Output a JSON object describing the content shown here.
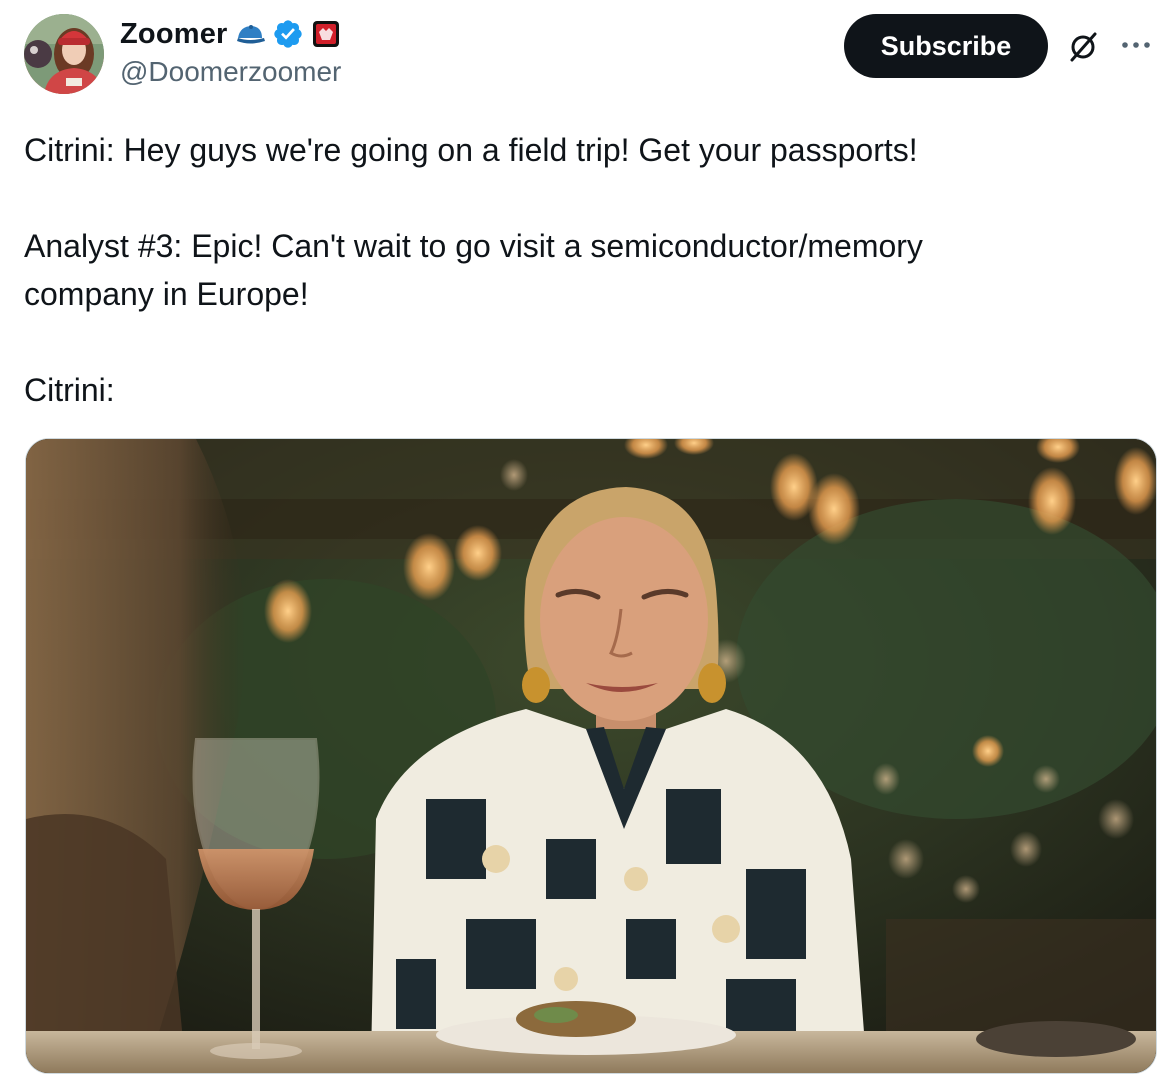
{
  "author": {
    "display_name": "Zoomer",
    "handle": "@Doomerzoomer",
    "avatar": "avatar-photo",
    "badges": [
      "blue-cap-emoji",
      "verified-badge",
      "red-emblem-affiliate"
    ]
  },
  "actions": {
    "subscribe_label": "Subscribe",
    "grok_icon": "grok-slash-circle-icon",
    "more_icon": "ellipsis-icon"
  },
  "tweet": {
    "lines": [
      "Citrini: Hey guys we're going on a field trip! Get your passports!",
      "Analyst #3: Epic! Can't wait to go visit a semiconductor/memory company in Europe!",
      "Citrini:"
    ]
  },
  "media": {
    "type": "image",
    "description_icon": "photo-woman-at-restaurant"
  },
  "colors": {
    "text": "#0f1419",
    "secondary": "#536471",
    "verified": "#1d9bf0",
    "button_bg": "#0f1419",
    "border": "#cfd9de"
  }
}
